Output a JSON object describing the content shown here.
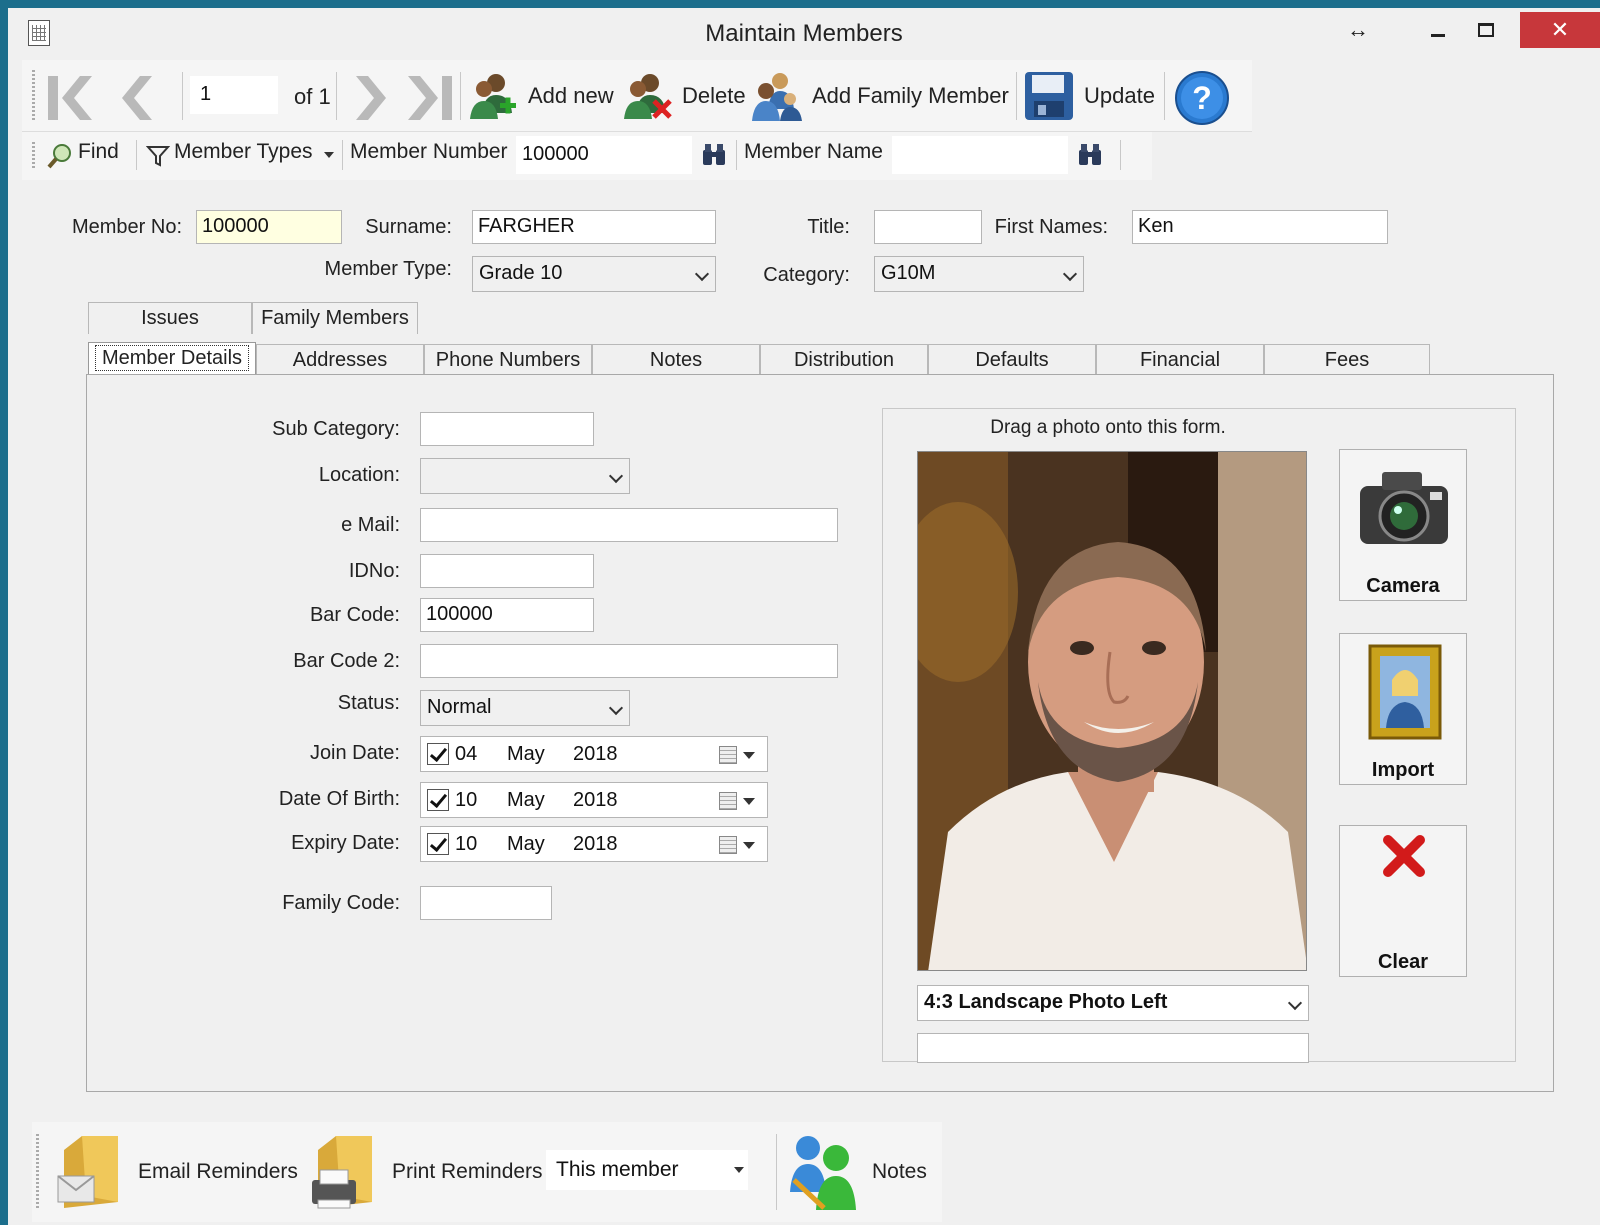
{
  "window": {
    "title": "Maintain Members"
  },
  "toolbar": {
    "record_position": "1",
    "record_total": "of 1",
    "add_new_label": "Add new",
    "delete_label": "Delete",
    "add_family_label": "Add Family Member",
    "update_label": "Update"
  },
  "searchbar": {
    "find_label": "Find",
    "member_types_label": "Member Types",
    "member_number_label": "Member Number",
    "member_number_value": "100000",
    "member_name_label": "Member Name",
    "member_name_value": ""
  },
  "header": {
    "member_no_label": "Member No:",
    "member_no_value": "100000",
    "surname_label": "Surname:",
    "surname_value": "FARGHER",
    "title_label": "Title:",
    "title_value": "",
    "first_names_label": "First Names:",
    "first_names_value": "Ken",
    "member_type_label": "Member Type:",
    "member_type_value": "Grade 10",
    "category_label": "Category:",
    "category_value": "G10M"
  },
  "tabs_row1": [
    "Issues",
    "Family Members"
  ],
  "tabs_row2": [
    "Member Details",
    "Addresses",
    "Phone Numbers",
    "Notes",
    "Distribution",
    "Defaults",
    "Financial",
    "Fees"
  ],
  "details": {
    "sub_category_label": "Sub Category:",
    "sub_category_value": "",
    "location_label": "Location:",
    "location_value": "",
    "email_label": "e Mail:",
    "email_value": "",
    "idno_label": "IDNo:",
    "idno_value": "",
    "barcode_label": "Bar Code:",
    "barcode_value": "100000",
    "barcode2_label": "Bar Code 2:",
    "barcode2_value": "",
    "status_label": "Status:",
    "status_value": "Normal",
    "join_date_label": "Join Date:",
    "join_date": {
      "day": "04",
      "month": "May",
      "year": "2018"
    },
    "dob_label": "Date Of Birth:",
    "dob": {
      "day": "10",
      "month": "May",
      "year": "2018"
    },
    "expiry_label": "Expiry Date:",
    "expiry": {
      "day": "10",
      "month": "May",
      "year": "2018"
    },
    "family_code_label": "Family Code:",
    "family_code_value": ""
  },
  "photo": {
    "drag_hint": "Drag a photo onto this form.",
    "camera_label": "Camera",
    "import_label": "Import",
    "clear_label": "Clear",
    "layout_value": "4:3 Landscape Photo Left",
    "caption_value": ""
  },
  "bottom": {
    "email_reminders_label": "Email Reminders",
    "print_reminders_label": "Print Reminders",
    "scope_value": "This member",
    "notes_label": "Notes"
  },
  "colors": {
    "accent": "#1c6e8c",
    "close": "#c7373b",
    "highlight_field": "#ffffe1"
  }
}
